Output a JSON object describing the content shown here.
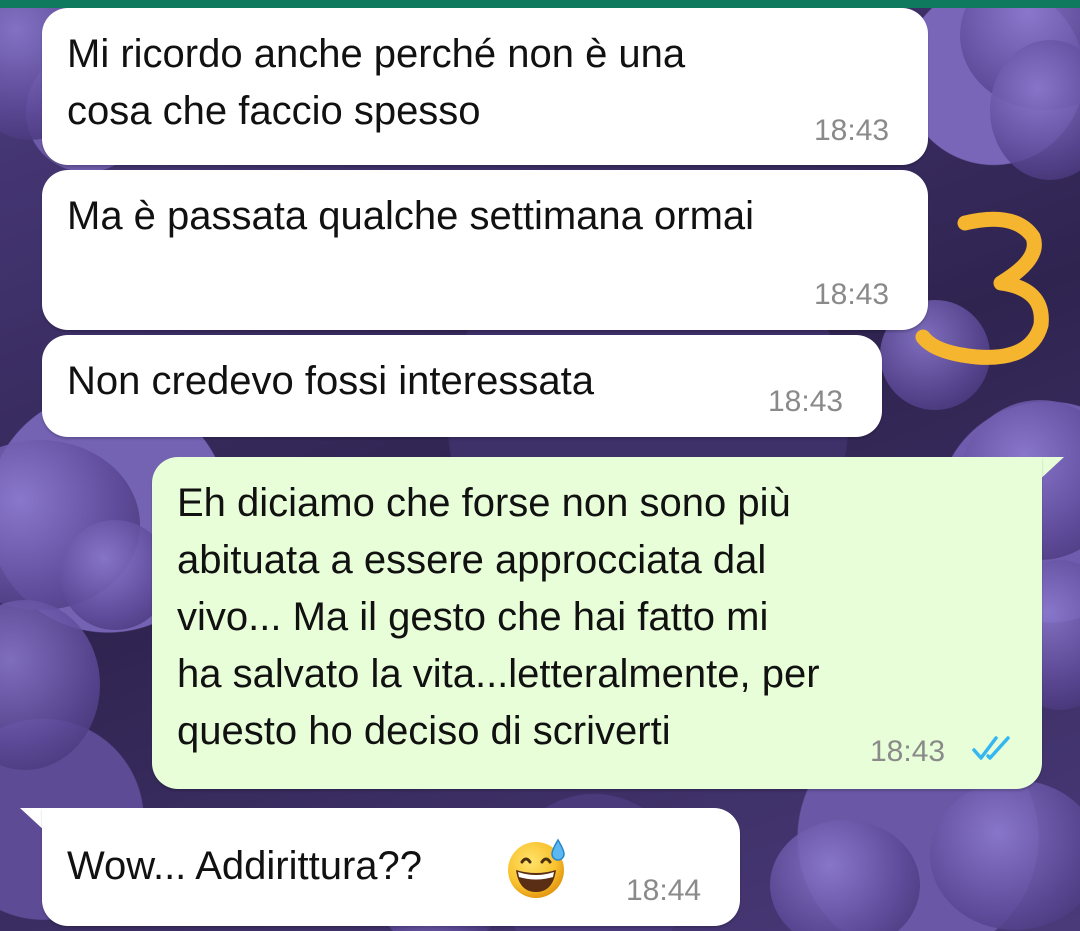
{
  "messages": [
    {
      "direction": "incoming",
      "text": "Mi ricordo anche perché non è una\ncosa che faccio spesso",
      "time": "18:43"
    },
    {
      "direction": "incoming",
      "text": "Ma è passata qualche settimana ormai",
      "time": "18:43"
    },
    {
      "direction": "incoming",
      "text": "Non credevo fossi interessata",
      "time": "18:43"
    },
    {
      "direction": "outgoing",
      "text": "Eh diciamo che forse non sono più\nabituata a essere approcciata dal\nvivo... Ma il gesto che hai fatto mi\nha salvato la vita...letteralmente, per\nquesto ho deciso di scriverti",
      "time": "18:43",
      "status": "read",
      "status_icon": "double-check-icon"
    },
    {
      "direction": "incoming",
      "text": "Wow... Addirittura??",
      "time": "18:44",
      "emoji": "grinning-face-with-sweat-icon"
    }
  ],
  "overlay_annotation": "3",
  "colors": {
    "header_green": "#0f7a5e",
    "incoming_bubble": "#ffffff",
    "outgoing_bubble": "#e7fed8",
    "timestamp": "#8a8a8a",
    "read_ticks": "#34b7f1",
    "annotation": "#f5b52e"
  }
}
